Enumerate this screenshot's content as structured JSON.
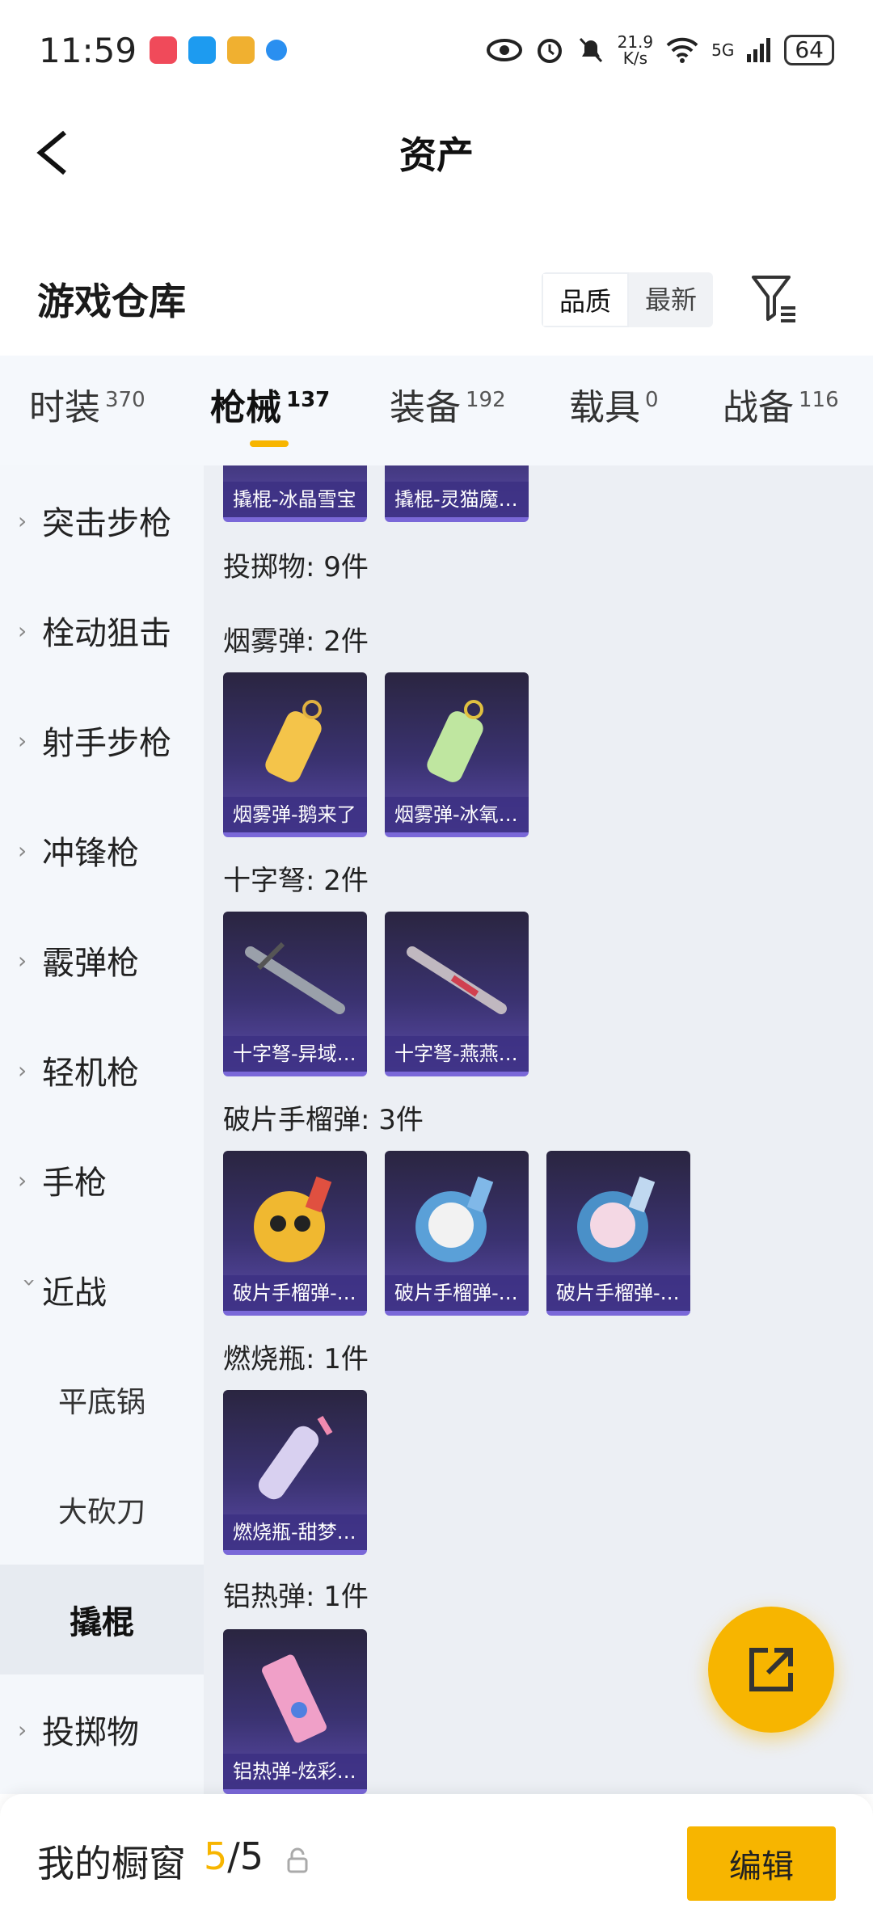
{
  "status_bar": {
    "time": "11:59",
    "net_speed_top": "21.9",
    "net_speed_bottom": "K/s",
    "signal": "5G",
    "battery": "64"
  },
  "header": {
    "title": "资产"
  },
  "warehouse": {
    "title": "游戏仓库",
    "sort_options": [
      "品质",
      "最新"
    ],
    "active_sort": "品质"
  },
  "tabs": [
    {
      "label": "时装",
      "count": "370"
    },
    {
      "label": "枪械",
      "count": "137",
      "active": true
    },
    {
      "label": "装备",
      "count": "192"
    },
    {
      "label": "载具",
      "count": "0"
    },
    {
      "label": "战备",
      "count": "116"
    }
  ],
  "sidebar": {
    "items": [
      "突击步枪",
      "栓动狙击",
      "射手步枪",
      "冲锋枪",
      "霰弹枪",
      "轻机枪",
      "手枪",
      "近战"
    ],
    "sub_items": [
      "平底锅",
      "大砍刀",
      "撬棍"
    ],
    "active_sub": "撬棍",
    "last_item": "投掷物"
  },
  "content": {
    "top_cards": [
      "撬棍-冰晶雪宝",
      "撬棍-灵猫魔…"
    ],
    "throwables_heading": "投掷物: 9件",
    "sections": [
      {
        "heading": "烟雾弹: 2件",
        "cards": [
          "烟雾弹-鹅来了",
          "烟雾弹-冰氧…"
        ]
      },
      {
        "heading": "十字弩: 2件",
        "cards": [
          "十字弩-异域…",
          "十字弩-燕燕…"
        ]
      },
      {
        "heading": "破片手榴弹: 3件",
        "cards": [
          "破片手榴弹-…",
          "破片手榴弹-…",
          "破片手榴弹-…"
        ]
      },
      {
        "heading": "燃烧瓶: 1件",
        "cards": [
          "燃烧瓶-甜梦…"
        ]
      },
      {
        "heading": "铝热弹: 1件",
        "cards": [
          "铝热弹-炫彩…"
        ]
      }
    ]
  },
  "bottom_bar": {
    "label": "我的橱窗",
    "current": "5",
    "separator": "/",
    "total": "5",
    "edit_label": "编辑"
  },
  "colors": {
    "accent": "#f7b500",
    "card_top": "#2a2540",
    "card_bottom": "#5a4aa8"
  }
}
